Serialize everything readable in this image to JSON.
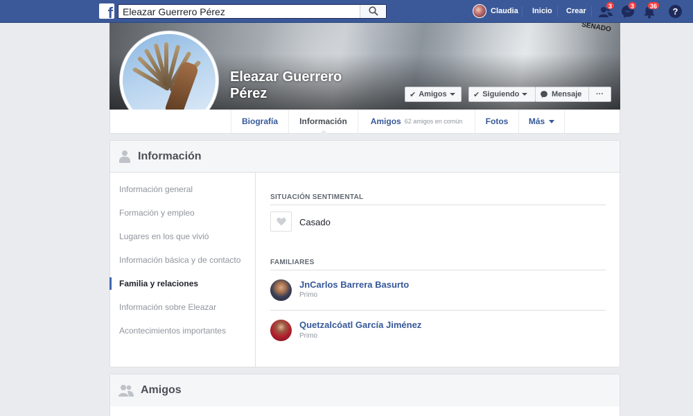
{
  "topbar": {
    "search_value": "Eleazar Guerrero Pérez",
    "search_icon": "search-icon",
    "user_name": "Claudia",
    "home_label": "Inicio",
    "create_label": "Crear",
    "friend_requests_count": "3",
    "messages_count": "3",
    "notifications_count": "36",
    "help_label": "?",
    "brand_color": "#3b5998",
    "badge_color": "#fa3e3e"
  },
  "cover": {
    "name": "Eleazar Guerrero Pérez",
    "sign_text": "SENADO",
    "buttons": {
      "friends": "Amigos",
      "following": "Siguiendo",
      "message": "Mensaje",
      "more": "···"
    }
  },
  "tabs": {
    "biography": "Biografía",
    "information": "Información",
    "friends": "Amigos",
    "friends_sub": "62 amigos en común",
    "photos": "Fotos",
    "more": "Más"
  },
  "info_card": {
    "title": "Información",
    "sidebar": [
      "Información general",
      "Formación y empleo",
      "Lugares en los que vivió",
      "Información básica y de contacto",
      "Familia y relaciones",
      "Información sobre Eleazar",
      "Acontecimientos importantes"
    ],
    "active_index": 4,
    "relationship_title": "SITUACIÓN SENTIMENTAL",
    "relationship_status": "Casado",
    "family_title": "FAMILIARES",
    "family": [
      {
        "name": "JnCarlos Barrera Basurto",
        "relation": "Primo"
      },
      {
        "name": "Quetzalcóatl García Jiménez",
        "relation": "Primo"
      }
    ]
  },
  "friends_card": {
    "title": "Amigos"
  }
}
